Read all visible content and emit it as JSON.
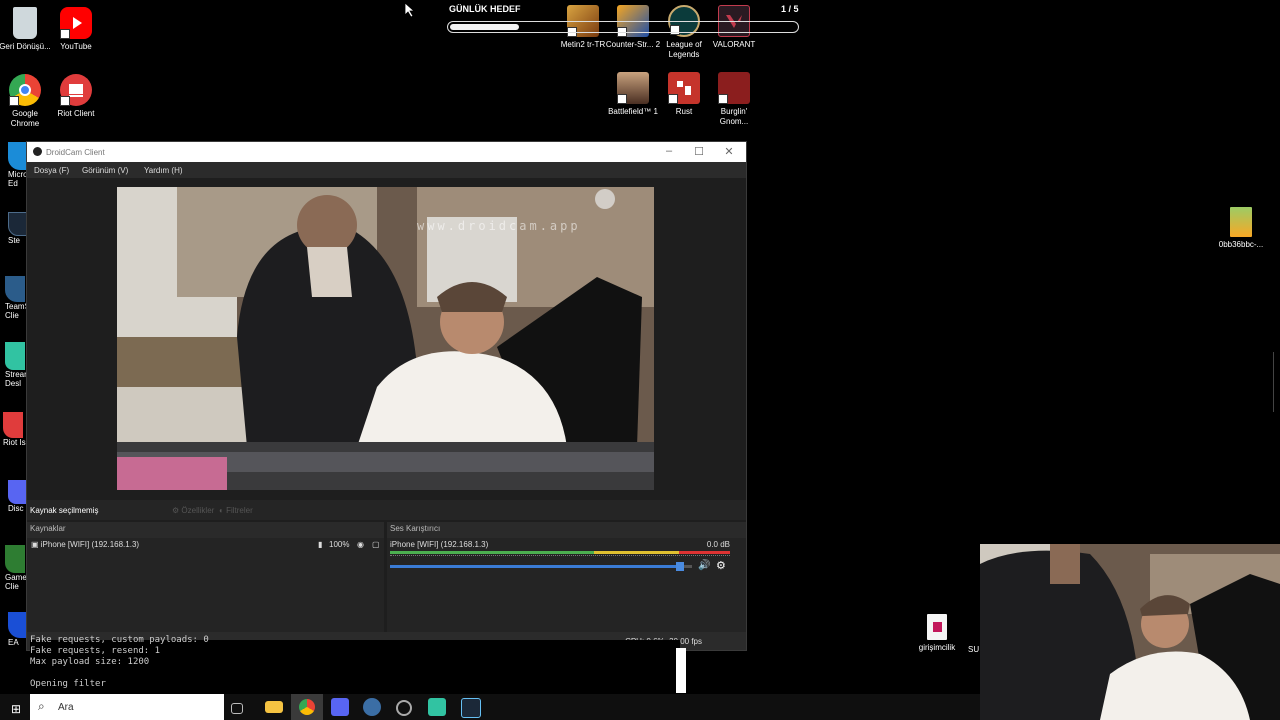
{
  "desktop": {
    "left_icons": [
      {
        "name": "recycle-bin-icon",
        "label": "Geri Dönüşü...",
        "color": "#cfd8dc"
      },
      {
        "name": "youtube-icon",
        "label": "YouTube",
        "color": "#ff0000"
      },
      {
        "name": "chrome-icon",
        "label": "Google Chrome",
        "color": "#34a853"
      },
      {
        "name": "riot-client-icon",
        "label": "Riot Client",
        "color": "#e03c3c"
      }
    ],
    "partial_icons": [
      "Micro Ed",
      "Ste",
      "TeamS Clie",
      "Strean Desl",
      "Riot Is",
      "Disc",
      "Game Clie",
      "EA"
    ],
    "games": [
      {
        "name": "metin2-icon",
        "label": "Metin2 tr-TR",
        "color": "#c98a2b"
      },
      {
        "name": "counter-strike-icon",
        "label": "Counter-Str... 2",
        "color": "#1f4fa8"
      },
      {
        "name": "league-icon",
        "label": "League of Legends",
        "color": "#0b3b3b"
      },
      {
        "name": "valorant-icon",
        "label": "VALORANT",
        "color": "#c23b4e"
      },
      {
        "name": "battlefield-icon",
        "label": "Battlefield™ 1",
        "color": "#6b4a3a"
      },
      {
        "name": "rust-icon",
        "label": "Rust",
        "color": "#c5342b"
      },
      {
        "name": "burglin-icon",
        "label": "Burglin' Gnom...",
        "color": "#8b1e1e"
      }
    ],
    "right_file_label": "0bb36bbc-...",
    "bottom_file_label": "girişimcilik",
    "bottom_file_partial": "SU"
  },
  "goal": {
    "title": "GÜNLÜK HEDEF",
    "count": "1 / 5",
    "progress": 0.2
  },
  "droidcam": {
    "title": "DroidCam Client",
    "menu": [
      "Dosya (F)",
      "Görünüm (V)",
      "Yardım (H)"
    ],
    "watermark": "www.droidcam.app",
    "no_source": "Kaynak seçilmemiş",
    "properties": "Özellikler",
    "filters": "Filtreler",
    "sources_header": "Kaynaklar",
    "source_name": "iPhone [WIFI] (192.168.1.3)",
    "source_volume": "100%",
    "mixer_header": "Ses Karıştırıcı",
    "mixer_source": "iPhone [WIFI] (192.168.1.3)",
    "mixer_db": "0.0 dB",
    "mixer_level": 0.96,
    "status": "CPU: 0.6%, 30.00 fps"
  },
  "terminal": [
    "Fake requests, custom payloads: 0",
    "Fake requests, resend: 1",
    "Max payload size: 1200",
    "",
    "Opening filter"
  ],
  "taskbar": {
    "search_placeholder": "Ara"
  }
}
